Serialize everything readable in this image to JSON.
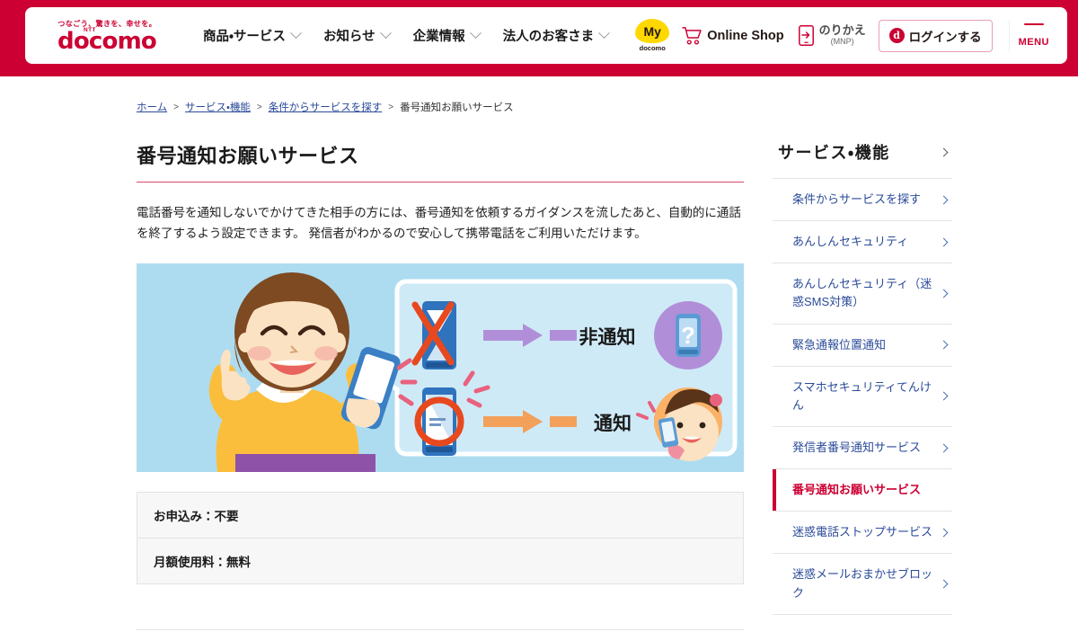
{
  "header": {
    "logo": {
      "tagline": "つなごう、驚きを、幸せを。",
      "ntt": "NTT",
      "name": "docomo"
    },
    "nav": [
      {
        "label": "商品・サービス",
        "icon": "chevron-down-icon"
      },
      {
        "label": "お知らせ",
        "icon": "chevron-down-icon"
      },
      {
        "label": "企業情報",
        "icon": "chevron-down-icon"
      },
      {
        "label": "法人のお客さま",
        "icon": "chevron-down-icon"
      }
    ],
    "utilities": {
      "mydocomo": {
        "main": "My",
        "sub": "docomo"
      },
      "online_shop": {
        "label": "Online Shop",
        "icon": "shopping-cart-icon"
      },
      "mnp": {
        "main": "のりかえ",
        "sub": "(MNP)",
        "icon": "phone-transfer-icon"
      },
      "login": {
        "label": "ログインする",
        "icon": "d-account-icon",
        "icon_letter": "d"
      },
      "menu": {
        "label": "MENU",
        "icon": "hamburger-icon"
      }
    }
  },
  "breadcrumb": {
    "items": [
      "ホーム",
      "サービス・機能",
      "条件からサービスを探す",
      "番号通知お願いサービス"
    ],
    "separator": ">"
  },
  "main": {
    "title": "番号通知お願いサービス",
    "description": "電話番号を通知しないでかけてきた相手の方には、番号通知を依頼するガイダンスを流したあと、自動的に通話を終了するよう設定できます。 発信者がわかるので安心して携帯電話をご利用いただけます。",
    "illustration": {
      "alt": "番号通知お願いサービスのイメージイラスト",
      "label_blocked": "非通知",
      "label_notified": "通知",
      "unknown_mark": "?"
    },
    "info_rows": [
      "お申込み：不要",
      "月額使用料：無料"
    ]
  },
  "sidebar": {
    "title": "サービス・機能",
    "items": [
      {
        "label": "条件からサービスを探す",
        "active": false
      },
      {
        "label": "あんしんセキュリティ",
        "active": false
      },
      {
        "label": "あんしんセキュリティ（迷惑SMS対策）",
        "active": false
      },
      {
        "label": "緊急通報位置通知",
        "active": false
      },
      {
        "label": "スマホセキュリティてんけん",
        "active": false
      },
      {
        "label": "発信者番号通知サービス",
        "active": false
      },
      {
        "label": "番号通知お願いサービス",
        "active": true
      },
      {
        "label": "迷惑電話ストップサービス",
        "active": false
      },
      {
        "label": "迷惑メールおまかせブロック",
        "active": false
      }
    ]
  },
  "colors": {
    "brand_red": "#cc0033",
    "link_blue": "#2b4b99",
    "hero_bg": "#addcf0",
    "accent_yellow": "#ffd800",
    "title_rule": "#d94a6a"
  }
}
